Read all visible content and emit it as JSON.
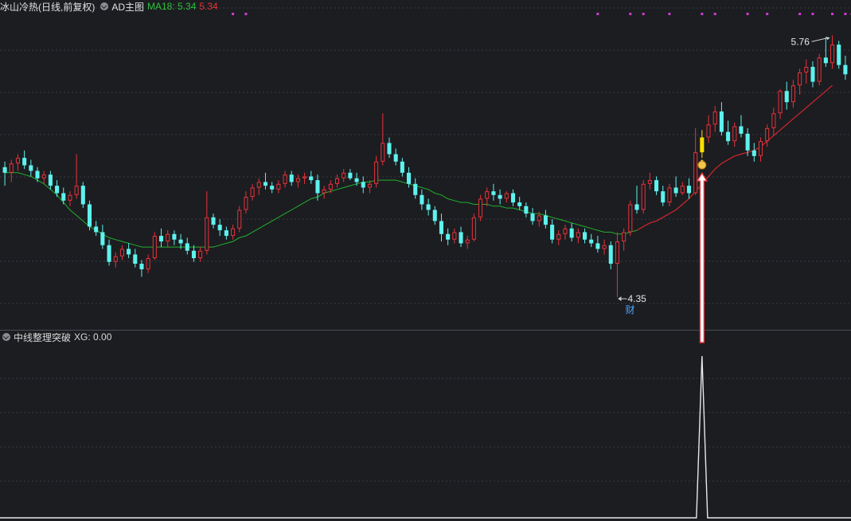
{
  "header_top": {
    "stock_title": "冰山冷热(日线,前复权)",
    "indicator_name": "AD主图",
    "ma_label": "MA18: 5.34",
    "ma_value2": "5.34"
  },
  "header_sub": {
    "indicator_name": "中线整理突破",
    "xg_label": "XG: 0.00"
  },
  "colors": {
    "background": "#1c1d21",
    "up_candle": "#e8323a",
    "down_candle": "#5ef2ee",
    "ma18_line": "#d1272c",
    "ma_green_line": "#21b02e",
    "highlight_candle": "#ffe000",
    "signal_dots": "#d43ad4",
    "grid": "#3a3c44"
  },
  "chart_data": [
    {
      "type": "candlestick",
      "title": "冰山冷热(日线,前复权)",
      "y_range": [
        4.2,
        5.95
      ],
      "annotations": {
        "high_label": "5.76",
        "low_label": "4.35",
        "low_marker_text": "财",
        "signal_icon": "money-bag-icon"
      },
      "signal_dots_present": true,
      "ohlc": [
        [
          5.05,
          5.08,
          4.95,
          5.02
        ],
        [
          5.02,
          5.09,
          4.97,
          5.07
        ],
        [
          5.07,
          5.12,
          5.03,
          5.1
        ],
        [
          5.1,
          5.14,
          5.04,
          5.06
        ],
        [
          5.06,
          5.09,
          5.0,
          5.03
        ],
        [
          5.03,
          5.05,
          4.97,
          4.99
        ],
        [
          4.99,
          5.03,
          4.96,
          5.01
        ],
        [
          5.01,
          5.03,
          4.93,
          4.95
        ],
        [
          4.95,
          4.98,
          4.89,
          4.91
        ],
        [
          4.91,
          4.94,
          4.85,
          4.87
        ],
        [
          4.87,
          4.92,
          4.84,
          4.9
        ],
        [
          4.9,
          5.12,
          4.88,
          4.95
        ],
        [
          4.95,
          4.97,
          4.83,
          4.85
        ],
        [
          4.85,
          4.87,
          4.71,
          4.73
        ],
        [
          4.73,
          4.76,
          4.68,
          4.7
        ],
        [
          4.7,
          4.74,
          4.61,
          4.63
        ],
        [
          4.63,
          4.66,
          4.52,
          4.54
        ],
        [
          4.54,
          4.59,
          4.51,
          4.57
        ],
        [
          4.57,
          4.63,
          4.55,
          4.61
        ],
        [
          4.61,
          4.64,
          4.56,
          4.58
        ],
        [
          4.58,
          4.61,
          4.51,
          4.53
        ],
        [
          4.53,
          4.55,
          4.46,
          4.5
        ],
        [
          4.5,
          4.58,
          4.48,
          4.56
        ],
        [
          4.56,
          4.7,
          4.55,
          4.68
        ],
        [
          4.68,
          4.72,
          4.62,
          4.65
        ],
        [
          4.65,
          4.71,
          4.62,
          4.69
        ],
        [
          4.69,
          4.71,
          4.63,
          4.66
        ],
        [
          4.66,
          4.69,
          4.61,
          4.64
        ],
        [
          4.64,
          4.67,
          4.58,
          4.6
        ],
        [
          4.6,
          4.63,
          4.54,
          4.56
        ],
        [
          4.56,
          4.62,
          4.54,
          4.6
        ],
        [
          4.6,
          4.92,
          4.58,
          4.78
        ],
        [
          4.78,
          4.8,
          4.72,
          4.74
        ],
        [
          4.74,
          4.77,
          4.68,
          4.71
        ],
        [
          4.71,
          4.73,
          4.66,
          4.68
        ],
        [
          4.68,
          4.74,
          4.66,
          4.72
        ],
        [
          4.72,
          4.84,
          4.7,
          4.82
        ],
        [
          4.82,
          4.92,
          4.8,
          4.89
        ],
        [
          4.89,
          4.96,
          4.87,
          4.94
        ],
        [
          4.94,
          4.99,
          4.9,
          4.97
        ],
        [
          4.97,
          5.02,
          4.93,
          4.95
        ],
        [
          4.95,
          4.97,
          4.91,
          4.93
        ],
        [
          4.93,
          4.98,
          4.91,
          4.96
        ],
        [
          4.96,
          5.03,
          4.94,
          5.01
        ],
        [
          5.01,
          5.03,
          4.95,
          4.97
        ],
        [
          4.97,
          5.01,
          4.94,
          4.99
        ],
        [
          4.99,
          5.02,
          4.96,
          5.0
        ],
        [
          5.0,
          5.03,
          4.96,
          4.98
        ],
        [
          4.98,
          5.01,
          4.87,
          4.91
        ],
        [
          4.91,
          4.95,
          4.88,
          4.93
        ],
        [
          4.93,
          4.98,
          4.91,
          4.96
        ],
        [
          4.96,
          5.01,
          4.94,
          4.99
        ],
        [
          4.99,
          5.04,
          4.97,
          5.02
        ],
        [
          5.02,
          5.04,
          4.98,
          4.99
        ],
        [
          4.99,
          5.02,
          4.95,
          4.97
        ],
        [
          4.97,
          5.0,
          4.91,
          4.94
        ],
        [
          4.94,
          4.98,
          4.91,
          4.96
        ],
        [
          4.96,
          5.11,
          4.94,
          5.08
        ],
        [
          5.08,
          5.34,
          5.06,
          5.18
        ],
        [
          5.18,
          5.21,
          5.1,
          5.12
        ],
        [
          5.12,
          5.15,
          5.06,
          5.08
        ],
        [
          5.08,
          5.1,
          5.0,
          5.02
        ],
        [
          5.02,
          5.05,
          4.94,
          4.96
        ],
        [
          4.96,
          4.99,
          4.88,
          4.9
        ],
        [
          4.9,
          4.93,
          4.82,
          4.85
        ],
        [
          4.85,
          4.88,
          4.79,
          4.82
        ],
        [
          4.82,
          4.84,
          4.74,
          4.76
        ],
        [
          4.76,
          4.8,
          4.65,
          4.69
        ],
        [
          4.69,
          4.72,
          4.63,
          4.66
        ],
        [
          4.66,
          4.72,
          4.64,
          4.7
        ],
        [
          4.7,
          4.73,
          4.62,
          4.64
        ],
        [
          4.64,
          4.68,
          4.61,
          4.66
        ],
        [
          4.66,
          4.8,
          4.65,
          4.78
        ],
        [
          4.78,
          4.9,
          4.76,
          4.88
        ],
        [
          4.88,
          4.94,
          4.84,
          4.92
        ],
        [
          4.92,
          4.96,
          4.87,
          4.9
        ],
        [
          4.9,
          4.93,
          4.85,
          4.88
        ],
        [
          4.88,
          4.92,
          4.86,
          4.91
        ],
        [
          4.91,
          4.93,
          4.84,
          4.86
        ],
        [
          4.86,
          4.89,
          4.82,
          4.84
        ],
        [
          4.84,
          4.86,
          4.78,
          4.8
        ],
        [
          4.8,
          4.83,
          4.74,
          4.76
        ],
        [
          4.76,
          4.81,
          4.73,
          4.79
        ],
        [
          4.79,
          4.82,
          4.72,
          4.74
        ],
        [
          4.74,
          4.77,
          4.64,
          4.66
        ],
        [
          4.66,
          4.71,
          4.63,
          4.69
        ],
        [
          4.69,
          4.74,
          4.66,
          4.72
        ],
        [
          4.72,
          4.75,
          4.65,
          4.67
        ],
        [
          4.67,
          4.72,
          4.64,
          4.7
        ],
        [
          4.7,
          4.72,
          4.64,
          4.66
        ],
        [
          4.66,
          4.69,
          4.62,
          4.64
        ],
        [
          4.64,
          4.68,
          4.59,
          4.61
        ],
        [
          4.61,
          4.66,
          4.58,
          4.63
        ],
        [
          4.63,
          4.65,
          4.5,
          4.53
        ],
        [
          4.53,
          4.7,
          4.35,
          4.65
        ],
        [
          4.65,
          4.72,
          4.6,
          4.7
        ],
        [
          4.7,
          4.87,
          4.68,
          4.85
        ],
        [
          4.85,
          4.95,
          4.8,
          4.82
        ],
        [
          4.82,
          4.98,
          4.8,
          4.96
        ],
        [
          4.96,
          5.02,
          4.93,
          4.98
        ],
        [
          4.98,
          5.0,
          4.9,
          4.92
        ],
        [
          4.92,
          4.95,
          4.84,
          4.86
        ],
        [
          4.86,
          4.96,
          4.84,
          4.94
        ],
        [
          4.94,
          5.0,
          4.89,
          4.91
        ],
        [
          4.91,
          4.97,
          4.9,
          4.95
        ],
        [
          4.95,
          4.99,
          4.88,
          4.91
        ],
        [
          4.91,
          5.26,
          4.9,
          5.13
        ],
        [
          5.13,
          5.25,
          5.1,
          5.21
        ],
        [
          5.21,
          5.33,
          5.18,
          5.28
        ],
        [
          5.28,
          5.38,
          5.24,
          5.35
        ],
        [
          5.35,
          5.4,
          5.22,
          5.24
        ],
        [
          5.24,
          5.3,
          5.17,
          5.19
        ],
        [
          5.19,
          5.29,
          5.16,
          5.27
        ],
        [
          5.27,
          5.33,
          5.21,
          5.23
        ],
        [
          5.23,
          5.26,
          5.11,
          5.14
        ],
        [
          5.14,
          5.18,
          5.08,
          5.11
        ],
        [
          5.11,
          5.21,
          5.08,
          5.19
        ],
        [
          5.19,
          5.28,
          5.16,
          5.26
        ],
        [
          5.26,
          5.37,
          5.22,
          5.34
        ],
        [
          5.34,
          5.47,
          5.31,
          5.46
        ],
        [
          5.46,
          5.51,
          5.36,
          5.4
        ],
        [
          5.4,
          5.52,
          5.37,
          5.49
        ],
        [
          5.49,
          5.58,
          5.44,
          5.56
        ],
        [
          5.56,
          5.63,
          5.5,
          5.59
        ],
        [
          5.59,
          5.62,
          5.48,
          5.51
        ],
        [
          5.51,
          5.66,
          5.49,
          5.64
        ],
        [
          5.64,
          5.75,
          5.59,
          5.61
        ],
        [
          5.61,
          5.76,
          5.58,
          5.71
        ],
        [
          5.71,
          5.73,
          5.58,
          5.6
        ],
        [
          5.6,
          5.65,
          5.52,
          5.55
        ]
      ],
      "ma18": [
        5.02,
        5.02,
        5.02,
        5.01,
        5.0,
        4.98,
        4.96,
        4.93,
        4.9,
        4.86,
        4.82,
        4.79,
        4.76,
        4.73,
        4.71,
        4.69,
        4.67,
        4.66,
        4.65,
        4.64,
        4.63,
        4.62,
        4.62,
        4.62,
        4.62,
        4.62,
        4.62,
        4.62,
        4.62,
        4.62,
        4.62,
        4.62,
        4.62,
        4.63,
        4.64,
        4.65,
        4.67,
        4.68,
        4.7,
        4.72,
        4.74,
        4.76,
        4.78,
        4.8,
        4.82,
        4.84,
        4.86,
        4.88,
        4.89,
        4.91,
        4.92,
        4.93,
        4.94,
        4.95,
        4.96,
        4.97,
        4.97,
        4.98,
        4.98,
        4.98,
        4.98,
        4.97,
        4.96,
        4.95,
        4.94,
        4.93,
        4.91,
        4.9,
        4.88,
        4.87,
        4.86,
        4.86,
        4.85,
        4.85,
        4.85,
        4.84,
        4.84,
        4.83,
        4.83,
        4.82,
        4.81,
        4.8,
        4.8,
        4.79,
        4.78,
        4.77,
        4.76,
        4.75,
        4.74,
        4.73,
        4.72,
        4.71,
        4.7,
        4.7,
        4.69,
        4.69,
        4.7,
        4.71,
        4.73,
        4.75,
        4.76,
        4.78,
        4.8,
        4.82,
        4.85,
        4.88,
        4.92,
        4.96,
        5.0,
        5.04,
        5.07,
        5.09,
        5.11,
        5.12,
        5.13,
        5.14,
        5.16,
        5.19,
        5.22,
        5.25,
        5.28,
        5.31,
        5.34,
        5.37,
        5.4,
        5.43,
        5.46,
        5.49
      ],
      "ma_green_until_index": 97,
      "highlight_index": 107
    },
    {
      "type": "line",
      "title": "中线整理突破",
      "series": [
        {
          "name": "XG",
          "peak_index": 107,
          "peak_value": 1,
          "baseline": 0
        }
      ]
    }
  ]
}
